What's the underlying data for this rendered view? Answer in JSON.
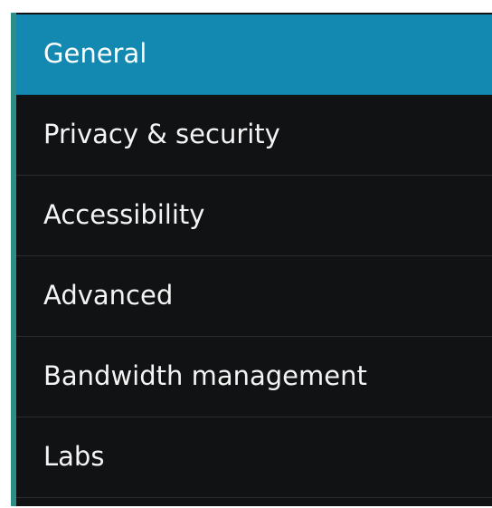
{
  "settings_menu": {
    "items": [
      {
        "label": "General",
        "selected": true
      },
      {
        "label": "Privacy & security",
        "selected": false
      },
      {
        "label": "Accessibility",
        "selected": false
      },
      {
        "label": "Advanced",
        "selected": false
      },
      {
        "label": "Bandwidth management",
        "selected": false
      },
      {
        "label": "Labs",
        "selected": false
      }
    ]
  },
  "colors": {
    "background": "#111214",
    "selected": "#1388b0",
    "divider": "#2a2c31",
    "left_edge": "#2c8e86",
    "text": "#f4f4f4"
  }
}
